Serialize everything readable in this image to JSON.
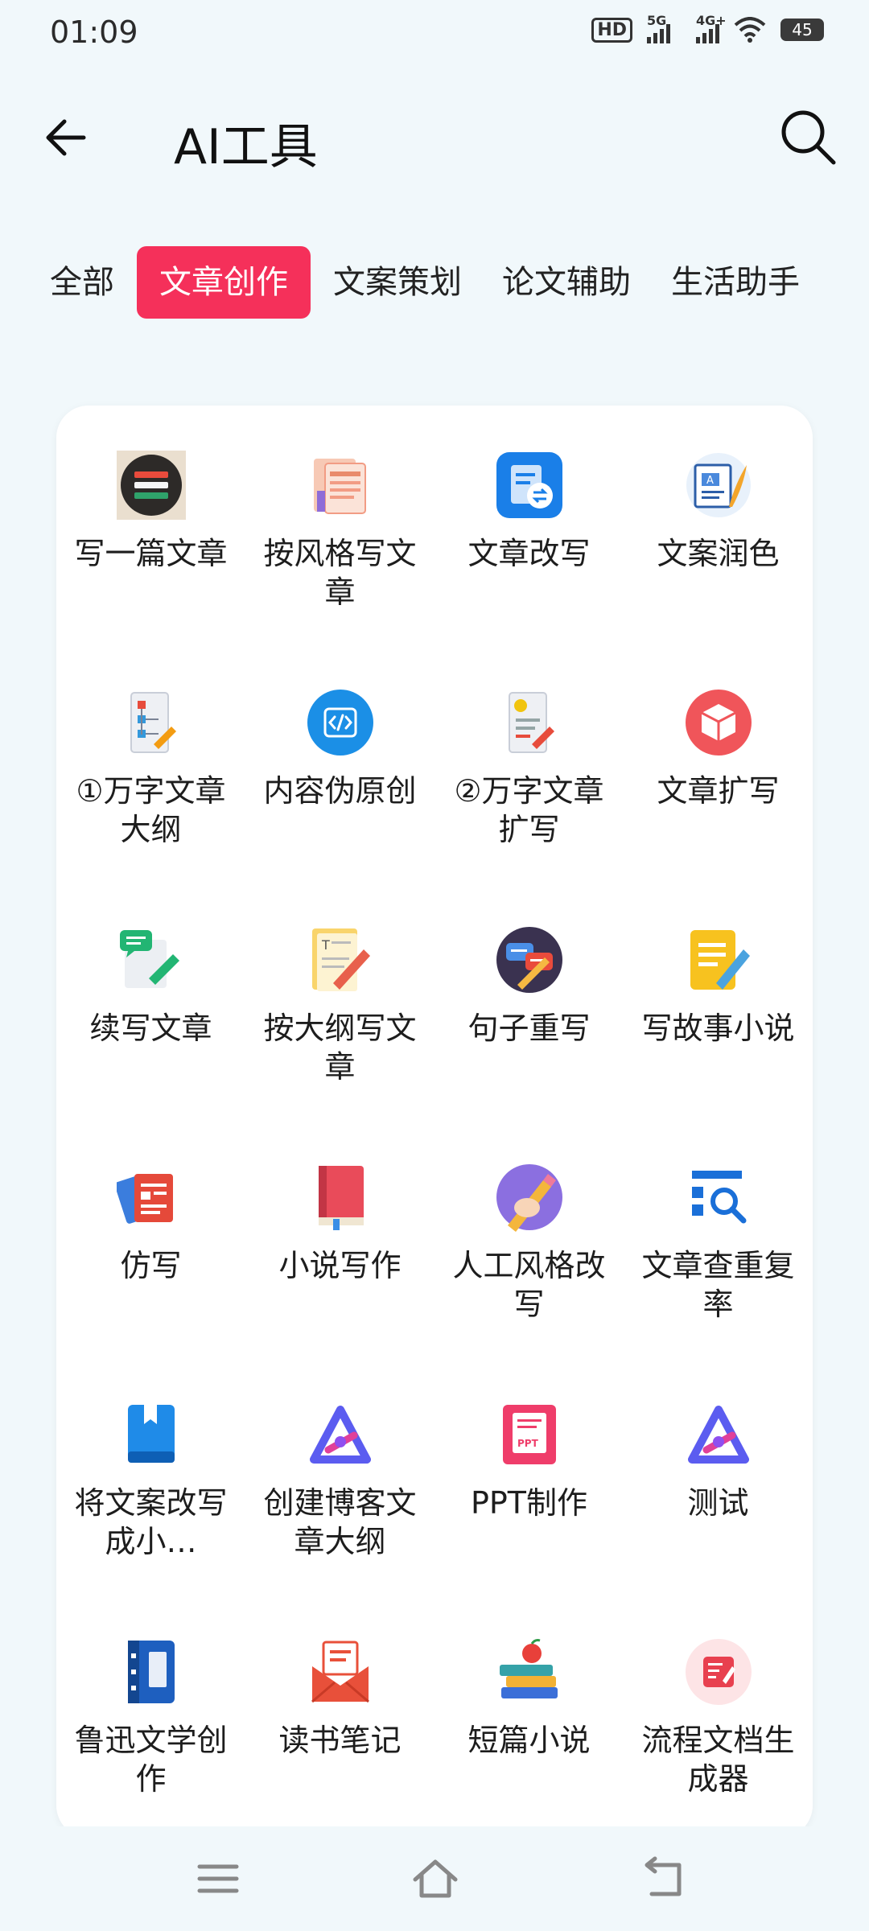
{
  "status_bar": {
    "time": "01:09",
    "hd_label": "HD",
    "sim2": "2",
    "net1": "5G",
    "net2": "4G+",
    "battery": "45"
  },
  "header": {
    "title": "AI工具"
  },
  "tabs": [
    {
      "label": "全部"
    },
    {
      "label": "文章创作"
    },
    {
      "label": "文案策划"
    },
    {
      "label": "论文辅助"
    },
    {
      "label": "生活助手"
    }
  ],
  "tools": [
    {
      "label": "写一篇文章",
      "icon": "stack-docs-icon"
    },
    {
      "label": "按风格写文章",
      "icon": "style-doc-icon"
    },
    {
      "label": "文章改写",
      "icon": "rewrite-doc-icon"
    },
    {
      "label": "文案润色",
      "icon": "polish-doc-icon"
    },
    {
      "label": "①万字文章大纲",
      "icon": "outline-doc-icon"
    },
    {
      "label": "内容伪原创",
      "icon": "code-icon"
    },
    {
      "label": "②万字文章扩写",
      "icon": "expand-doc-icon"
    },
    {
      "label": "文章扩写",
      "icon": "box-icon"
    },
    {
      "label": "续写文章",
      "icon": "chat-pen-icon"
    },
    {
      "label": "按大纲写文章",
      "icon": "notepad-pen-icon"
    },
    {
      "label": "句子重写",
      "icon": "chat-bubbles-icon"
    },
    {
      "label": "写故事小说",
      "icon": "note-pen-icon"
    },
    {
      "label": "仿写",
      "icon": "cards-icon"
    },
    {
      "label": "小说写作",
      "icon": "book-icon"
    },
    {
      "label": "人工风格改写",
      "icon": "hand-pencil-icon"
    },
    {
      "label": "文章查重复率",
      "icon": "search-doc-icon"
    },
    {
      "label": "将文案改写成小…",
      "icon": "bookmark-book-icon"
    },
    {
      "label": "创建博客文章大纲",
      "icon": "triangle-logo-icon"
    },
    {
      "label": "PPT制作",
      "icon": "ppt-icon"
    },
    {
      "label": "测试",
      "icon": "triangle-logo-icon"
    },
    {
      "label": "鲁迅文学创作",
      "icon": "notebook-icon"
    },
    {
      "label": "读书笔记",
      "icon": "envelope-icon"
    },
    {
      "label": "短篇小说",
      "icon": "books-apple-icon"
    },
    {
      "label": "流程文档生成器",
      "icon": "form-icon"
    }
  ]
}
